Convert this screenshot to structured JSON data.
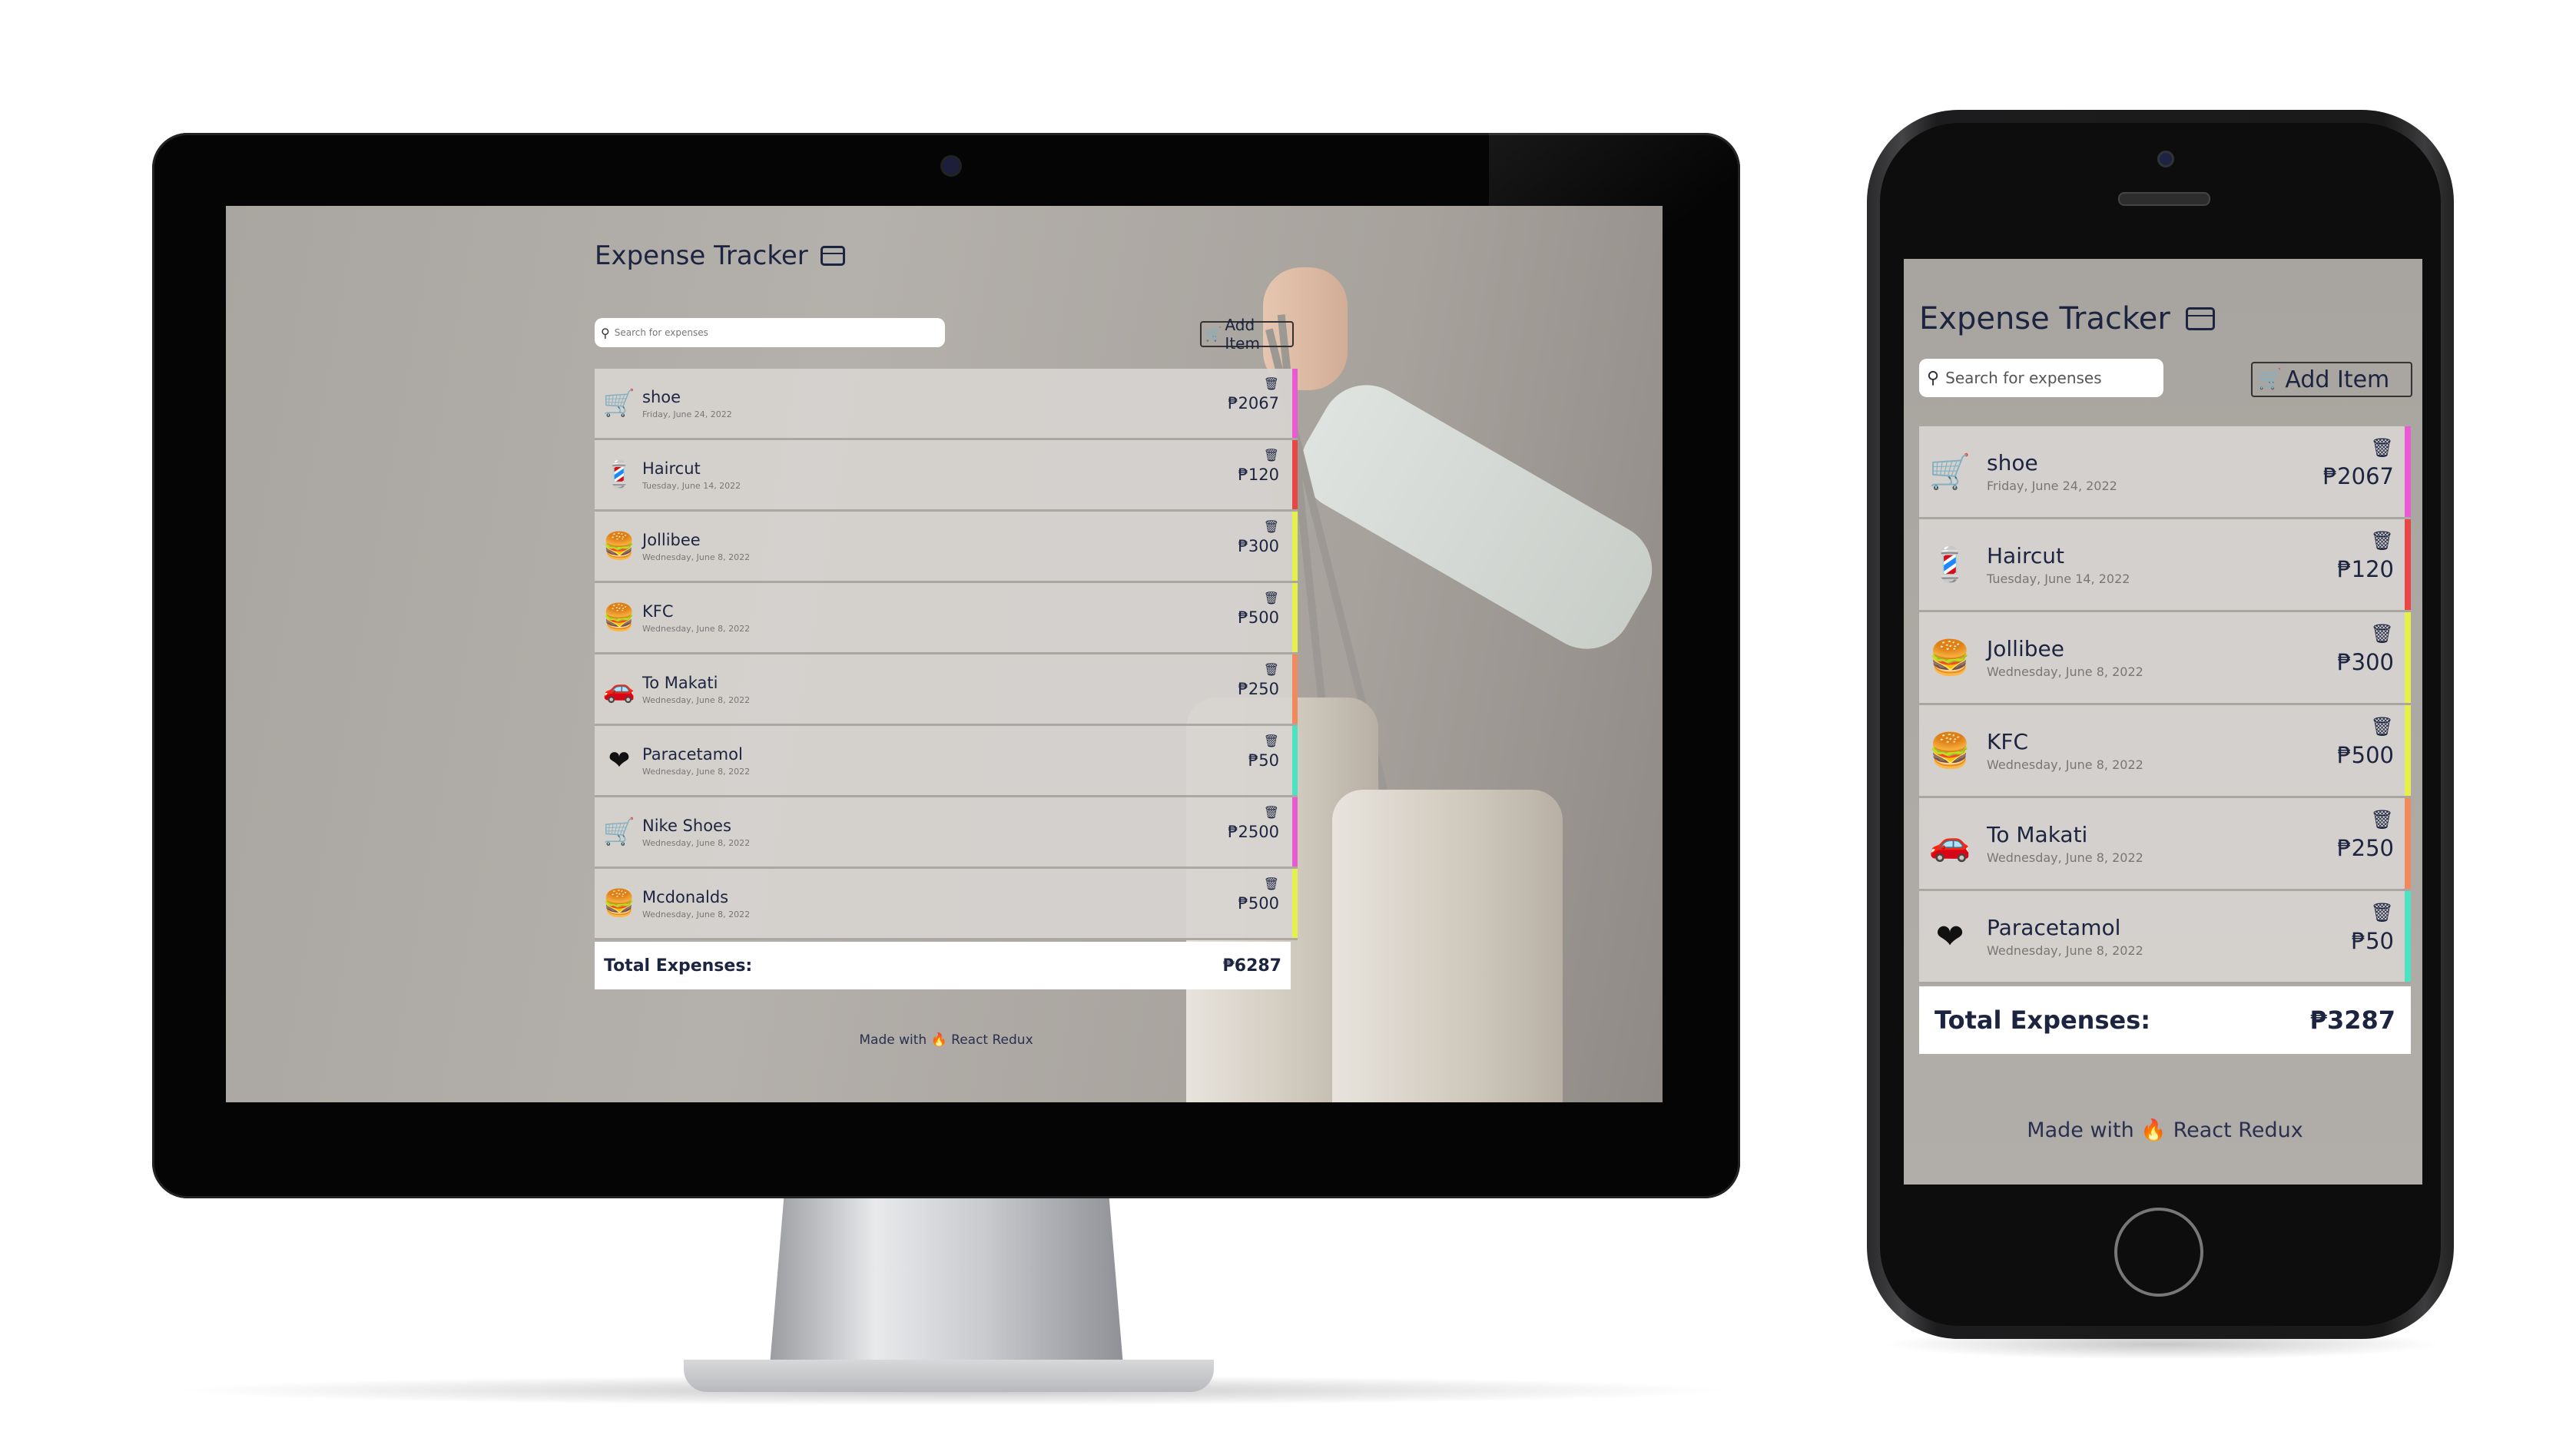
{
  "app": {
    "title": "Expense Tracker",
    "search_placeholder": "Search for expenses",
    "add_button_label": "Add Item",
    "total_label": "Total Expenses:",
    "footer_prefix": "Made with",
    "footer_suffix": "React Redux",
    "currency_symbol": "₱"
  },
  "desktop": {
    "items": [
      {
        "name": "shoe",
        "date": "Friday, June 24, 2022",
        "amount": "₱2067",
        "icon": "shopping-cart-icon",
        "color": "#e95ad3"
      },
      {
        "name": "Haircut",
        "date": "Tuesday, June 14, 2022",
        "amount": "₱120",
        "icon": "haircut-icon",
        "color": "#e84545"
      },
      {
        "name": "Jollibee",
        "date": "Wednesday, June 8, 2022",
        "amount": "₱300",
        "icon": "food-icon",
        "color": "#e6f04a"
      },
      {
        "name": "KFC",
        "date": "Wednesday, June 8, 2022",
        "amount": "₱500",
        "icon": "food-icon",
        "color": "#e6f04a"
      },
      {
        "name": "To Makati",
        "date": "Wednesday, June 8, 2022",
        "amount": "₱250",
        "icon": "transport-icon",
        "color": "#f08a5d"
      },
      {
        "name": "Paracetamol",
        "date": "Wednesday, June 8, 2022",
        "amount": "₱50",
        "icon": "health-icon",
        "color": "#4de3c2"
      },
      {
        "name": "Nike Shoes",
        "date": "Wednesday, June 8, 2022",
        "amount": "₱2500",
        "icon": "shopping-cart-icon",
        "color": "#e95ad3"
      },
      {
        "name": "Mcdonalds",
        "date": "Wednesday, June 8, 2022",
        "amount": "₱500",
        "icon": "food-icon",
        "color": "#e6f04a"
      }
    ],
    "total": "₱6287"
  },
  "mobile": {
    "items": [
      {
        "name": "shoe",
        "date": "Friday, June 24, 2022",
        "amount": "₱2067",
        "icon": "shopping-cart-icon",
        "color": "#e95ad3"
      },
      {
        "name": "Haircut",
        "date": "Tuesday, June 14, 2022",
        "amount": "₱120",
        "icon": "haircut-icon",
        "color": "#e84545"
      },
      {
        "name": "Jollibee",
        "date": "Wednesday, June 8, 2022",
        "amount": "₱300",
        "icon": "food-icon",
        "color": "#e6f04a"
      },
      {
        "name": "KFC",
        "date": "Wednesday, June 8, 2022",
        "amount": "₱500",
        "icon": "food-icon",
        "color": "#e6f04a"
      },
      {
        "name": "To Makati",
        "date": "Wednesday, June 8, 2022",
        "amount": "₱250",
        "icon": "transport-icon",
        "color": "#f08a5d"
      },
      {
        "name": "Paracetamol",
        "date": "Wednesday, June 8, 2022",
        "amount": "₱50",
        "icon": "health-icon",
        "color": "#4de3c2"
      }
    ],
    "total": "₱3287"
  }
}
